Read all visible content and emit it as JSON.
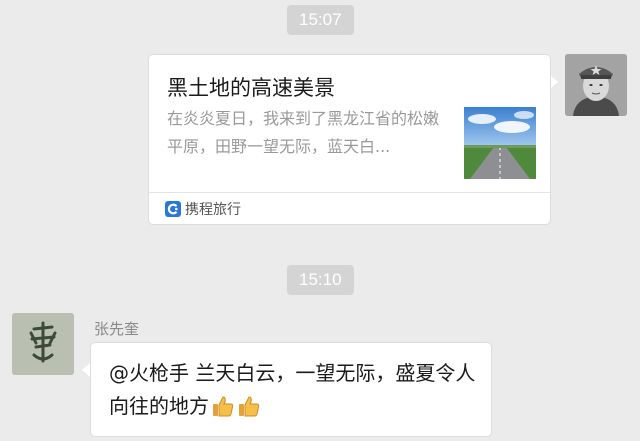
{
  "messages": {
    "time1": "15:07",
    "link_card": {
      "title": "黑土地的高速美景",
      "description": "在炎炎夏日，我来到了黑龙江省的松嫩平原，田野一望无际，蓝天白...",
      "source_name": "携程旅行",
      "thumbnail_icon": "highway-landscape-photo",
      "source_icon": "ctrip-logo-icon"
    },
    "time2": "15:10",
    "reply": {
      "sender": "张先奎",
      "text": "@火枪手 兰天白云，一望无际，盛夏令人向往的地方",
      "emoji": [
        "thumbs-up-icon",
        "thumbs-up-icon"
      ]
    }
  },
  "colors": {
    "background": "#ebebeb",
    "bubble": "#ffffff",
    "time_pill": "#d4d4d4",
    "accent_blue": "#2a78d6"
  }
}
